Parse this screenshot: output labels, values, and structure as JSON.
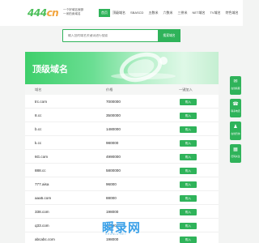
{
  "header": {
    "logo_mark_green": "444",
    "logo_mark_orange": "cn",
    "logo_tagline_1": "一个好域名就够",
    "logo_tagline_2": "一米拍卖域名",
    "nav": [
      {
        "label": "首页",
        "active": true
      },
      {
        "label": "顶级域名",
        "active": false
      },
      {
        "label": "SBASCD",
        "active": false
      },
      {
        "label": "五数米",
        "active": false
      },
      {
        "label": "六数米",
        "active": false
      },
      {
        "label": "三拼米",
        "active": false
      },
      {
        "label": "NET域名",
        "active": false
      },
      {
        "label": "TV域名",
        "active": false
      },
      {
        "label": "特色域名",
        "active": false
      }
    ]
  },
  "search": {
    "placeholder": "输入您的域名关键词进行搜索",
    "button_label": "搜索域名"
  },
  "section": {
    "title": "顶级域名"
  },
  "table": {
    "headers": [
      "域名",
      "价格",
      "一键加入"
    ],
    "buy_label": "购入",
    "rows": [
      {
        "domain": "trc.com",
        "price": "7000000"
      },
      {
        "domain": "8.cc",
        "price": "3500000"
      },
      {
        "domain": "b.cc",
        "price": "1480000"
      },
      {
        "domain": "k.cc",
        "price": "980000"
      },
      {
        "domain": "6G.com",
        "price": "4990000"
      },
      {
        "domain": "888.cc",
        "price": "5800000"
      },
      {
        "domain": "777.aisa",
        "price": "96000"
      },
      {
        "domain": "aaa5.com",
        "price": "88000"
      },
      {
        "domain": "338.com",
        "price": "198000"
      },
      {
        "domain": "q33.com",
        "price": "198000"
      },
      {
        "domain": "abcabc.com",
        "price": "198000"
      }
    ]
  },
  "float_bar": [
    {
      "icon": "chat-icon",
      "glyph": "✉",
      "label": "在线客服"
    },
    {
      "icon": "phone-icon",
      "glyph": "☎",
      "label": "联系电话"
    },
    {
      "icon": "user-icon",
      "glyph": "♟",
      "label": "在线咨询"
    },
    {
      "icon": "qrcode-icon",
      "glyph": "▦",
      "label": "扫码关注"
    }
  ],
  "watermark": {
    "text": "瞬录网",
    "sub": "SHUNLU.NET"
  },
  "colors": {
    "accent": "#2fb35a",
    "logo_orange": "#f2a33a",
    "watermark_blue": "#3aa0e8"
  }
}
